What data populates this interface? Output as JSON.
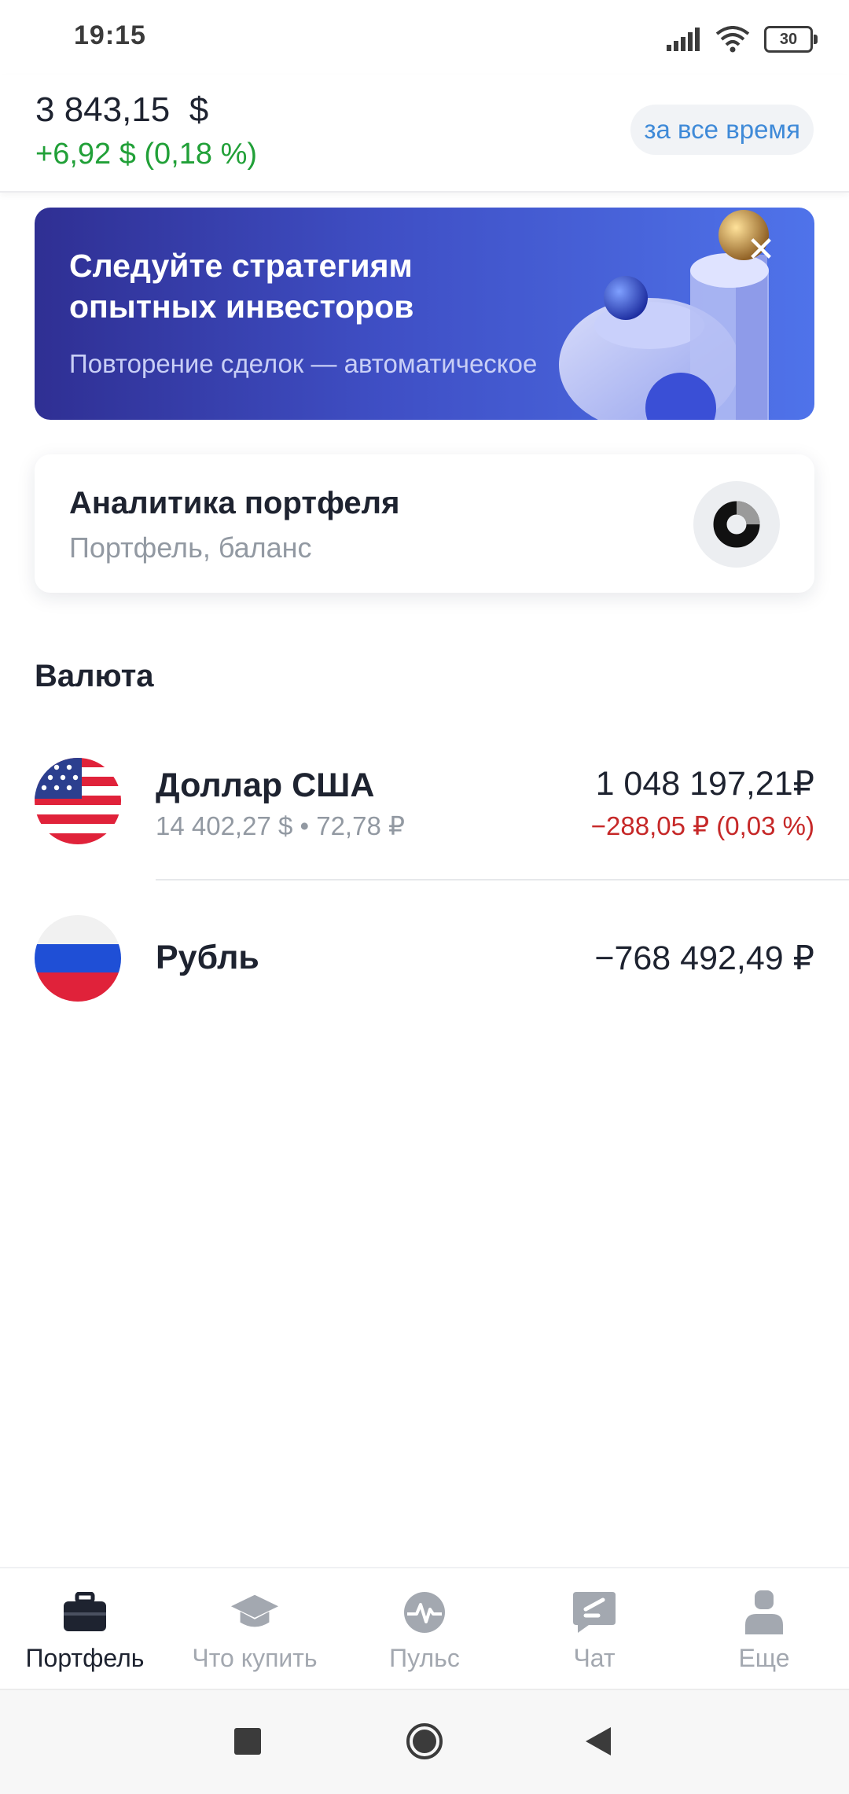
{
  "status_bar": {
    "time": "19:15",
    "battery": "30"
  },
  "header": {
    "total": "3 843,15  $",
    "change": "+6,92 $ (0,18 %)",
    "period": "за все время"
  },
  "banner": {
    "title_line1": "Следуйте стратегиям",
    "title_line2": "опытных инвесторов",
    "subtitle": "Повторение сделок — автоматическое",
    "close_icon": "close-icon"
  },
  "analytics": {
    "title": "Аналитика портфеля",
    "subtitle": "Портфель, баланс",
    "icon": "donut-chart-icon"
  },
  "section": {
    "title": "Валюта"
  },
  "assets": [
    {
      "name": "Доллар США",
      "meta": "14 402,27 $ • 72,78 ₽",
      "value": "1 048 197,21₽",
      "change": "−288,05 ₽ (0,03 %)",
      "flag": "us-flag-icon"
    },
    {
      "name": "Рубль",
      "value": "−768 492,49 ₽",
      "flag": "ru-flag-icon"
    }
  ],
  "bottom_nav": {
    "items": [
      {
        "label": "Портфель",
        "icon": "briefcase-icon",
        "active": true
      },
      {
        "label": "Что купить",
        "icon": "graduation-cap-icon",
        "active": false
      },
      {
        "label": "Пульс",
        "icon": "pulse-icon",
        "active": false
      },
      {
        "label": "Чат",
        "icon": "chat-icon",
        "active": false
      },
      {
        "label": "Еще",
        "icon": "profile-icon",
        "active": false
      }
    ]
  },
  "colors": {
    "positive": "#21a038",
    "negative": "#c62828",
    "accent": "#3f8ad8",
    "banner_start": "#2f2f93",
    "banner_end": "#4f73ea"
  }
}
